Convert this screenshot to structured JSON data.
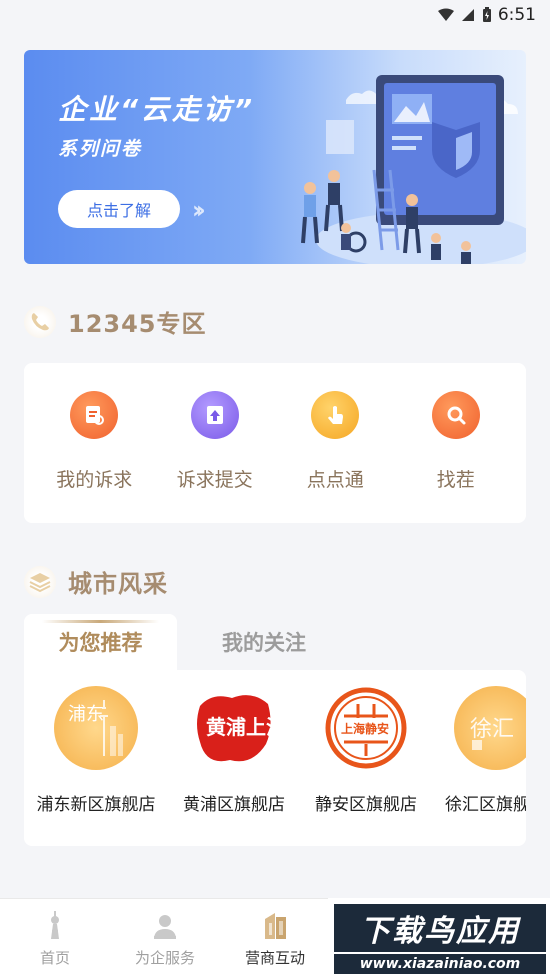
{
  "status_bar": {
    "time": "6:51"
  },
  "banner": {
    "title": "企业“云走访”",
    "subtitle": "系列问卷",
    "button_label": "点击了解"
  },
  "section_12345": {
    "title": "12345专区",
    "items": [
      {
        "label": "我的诉求",
        "icon": "complaint-doc-icon",
        "color": "#f2703a"
      },
      {
        "label": "诉求提交",
        "icon": "upload-icon",
        "color": "#8b6cf0"
      },
      {
        "label": "点点通",
        "icon": "tap-hand-icon",
        "color": "#f7b13a"
      },
      {
        "label": "找茬",
        "icon": "search-icon",
        "color": "#f5783a"
      }
    ]
  },
  "section_city": {
    "title": "城市风采",
    "tabs": [
      {
        "label": "为您推荐",
        "active": true
      },
      {
        "label": "我的关注",
        "active": false
      }
    ],
    "stores": [
      {
        "name": "浦东新区旗舰店",
        "logo_text": "浦东"
      },
      {
        "name": "黄浦区旗舰店",
        "logo_text": "黄浦上海"
      },
      {
        "name": "静安区旗舰店",
        "logo_text": "上海静安"
      },
      {
        "name": "徐汇区旗舰店",
        "logo_text": "徐汇"
      }
    ]
  },
  "bottom_nav": [
    {
      "label": "首页",
      "icon": "tower-icon",
      "active": false
    },
    {
      "label": "为企服务",
      "icon": "person-icon",
      "active": false
    },
    {
      "label": "营商互动",
      "icon": "building-icon",
      "active": true
    }
  ],
  "watermark": {
    "title": "下载鸟应用",
    "url": "www.xiazainiao.com"
  }
}
